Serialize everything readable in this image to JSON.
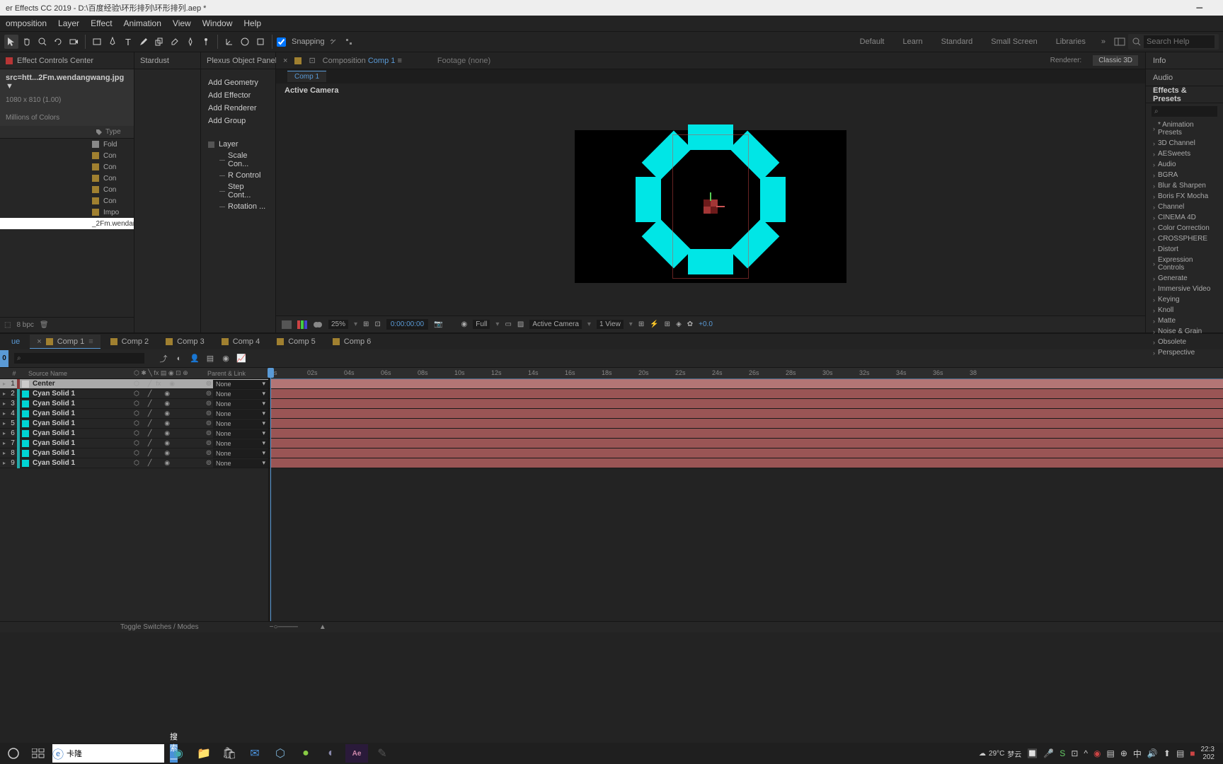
{
  "title_bar": {
    "text": "er Effects CC 2019 - D:\\百度经验\\环形排列\\环形排列.aep *"
  },
  "menu": [
    "omposition",
    "Layer",
    "Effect",
    "Animation",
    "View",
    "Window",
    "Help"
  ],
  "toolbar": {
    "snapping_label": "Snapping",
    "workspaces": [
      "Default",
      "Learn",
      "Standard",
      "Small Screen",
      "Libraries"
    ],
    "search_placeholder": "Search Help"
  },
  "effect_controls": {
    "tab": "Effect Controls Center",
    "asset_name": "src=htt...2Fm.wendangwang.jpg ▼",
    "asset_dims": "1080 x 810 (1.00)",
    "asset_colors": "Millions of Colors"
  },
  "project": {
    "header_type": "Type",
    "items": [
      "Fold",
      "Con",
      "Con",
      "Con",
      "Con",
      "Con",
      "Impo"
    ],
    "selected": "_2Fm.wendangwang.jpg",
    "footer_bpc": "8 bpc"
  },
  "stardust": {
    "tab": "Stardust"
  },
  "plexus": {
    "tab": "Plexus Object Panel",
    "add_items": [
      "Add Geometry",
      "Add Effector",
      "Add Renderer",
      "Add Group"
    ],
    "layer_label": "Layer",
    "tree": [
      "Scale Con...",
      "R Control",
      "Step Cont...",
      "Rotation ..."
    ]
  },
  "composition": {
    "breadcrumb_prefix": "Composition",
    "name": "Comp 1",
    "footage_label": "Footage",
    "footage_value": "(none)",
    "renderer_label": "Renderer:",
    "renderer_value": "Classic 3D",
    "subtab": "Comp 1",
    "active_camera": "Active Camera"
  },
  "viewer_footer": {
    "zoom": "25%",
    "time": "0:00:00:00",
    "resolution": "Full",
    "camera": "Active Camera",
    "views": "1 View",
    "exposure": "+0.0"
  },
  "right_panel": {
    "info": "Info",
    "audio": "Audio",
    "effects_presets": "Effects & Presets",
    "presets": [
      "* Animation Presets",
      "3D Channel",
      "AESweets",
      "Audio",
      "BGRA",
      "Blur & Sharpen",
      "Boris FX Mocha",
      "Channel",
      "CINEMA 4D",
      "Color Correction",
      "CROSSPHERE",
      "Distort",
      "Expression Controls",
      "Generate",
      "Immersive Video",
      "Keying",
      "Knoll",
      "Matte",
      "Noise & Grain",
      "Obsolete",
      "Perspective"
    ]
  },
  "timeline": {
    "tabs": [
      "ue",
      "Comp 1",
      "Comp 2",
      "Comp 3",
      "Comp 4",
      "Comp 5",
      "Comp 6"
    ],
    "time_badge": "0",
    "header_cols": {
      "num": "#",
      "name": "Source Name",
      "parent": "Parent & Link"
    },
    "layers": [
      {
        "num": "1",
        "name": "Center",
        "color": "#cccccc",
        "chip": "#8a3a3a",
        "selected": true
      },
      {
        "num": "2",
        "name": "Cyan Solid 1",
        "color": "#00d4d4",
        "chip": "#2aa",
        "selected": false
      },
      {
        "num": "3",
        "name": "Cyan Solid 1",
        "color": "#00d4d4",
        "chip": "#2aa",
        "selected": false
      },
      {
        "num": "4",
        "name": "Cyan Solid 1",
        "color": "#00d4d4",
        "chip": "#2aa",
        "selected": false
      },
      {
        "num": "5",
        "name": "Cyan Solid 1",
        "color": "#00d4d4",
        "chip": "#2aa",
        "selected": false
      },
      {
        "num": "6",
        "name": "Cyan Solid 1",
        "color": "#00d4d4",
        "chip": "#2aa",
        "selected": false
      },
      {
        "num": "7",
        "name": "Cyan Solid 1",
        "color": "#00d4d4",
        "chip": "#2aa",
        "selected": false
      },
      {
        "num": "8",
        "name": "Cyan Solid 1",
        "color": "#00d4d4",
        "chip": "#2aa",
        "selected": false
      },
      {
        "num": "9",
        "name": "Cyan Solid 1",
        "color": "#00d4d4",
        "chip": "#2aa",
        "selected": false
      }
    ],
    "parent_none": "None",
    "ruler_ticks": [
      "0s",
      "02s",
      "04s",
      "06s",
      "08s",
      "10s",
      "12s",
      "14s",
      "16s",
      "18s",
      "20s",
      "22s",
      "24s",
      "26s",
      "28s",
      "30s",
      "32s",
      "34s",
      "36s",
      "38"
    ],
    "footer_toggle": "Toggle Switches / Modes"
  },
  "taskbar": {
    "search_text": "卡隆",
    "search_btn": "搜索一下",
    "weather_temp": "29°C",
    "weather_cond": "梦云",
    "clock_time": "22:3",
    "clock_date": "202"
  }
}
